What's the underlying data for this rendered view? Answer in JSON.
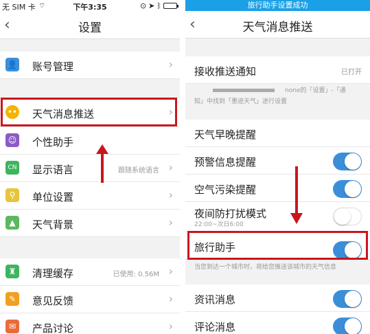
{
  "left": {
    "status": {
      "carrier": "无 SIM 卡 ",
      "time": "下午3:35"
    },
    "nav": {
      "title": "设置"
    },
    "rows": [
      {
        "label": "账号管理",
        "icon": "user-icon",
        "color": "#3e8fd8"
      },
      {
        "label": "天气消息推送",
        "icon": "smile-icon",
        "color": "#f5b400"
      },
      {
        "label": "个性助手",
        "icon": "assistant-icon",
        "color": "#8b5bc5"
      },
      {
        "label": "显示语言",
        "icon": "language-icon",
        "color": "#3db55f",
        "value": "跟随系统语言"
      },
      {
        "label": "单位设置",
        "icon": "unit-icon",
        "color": "#e8c43a"
      },
      {
        "label": "天气背景",
        "icon": "image-icon",
        "color": "#5cb860"
      },
      {
        "label": "清理缓存",
        "icon": "broom-icon",
        "color": "#3db55f",
        "value": "已使用: 0.56M"
      },
      {
        "label": "意见反馈",
        "icon": "pencil-icon",
        "color": "#f0a020"
      },
      {
        "label": "产品讨论",
        "icon": "chat-icon",
        "color": "#ea6b3a"
      }
    ]
  },
  "right": {
    "toast": "旅行助手设置成功",
    "nav": {
      "title": "天气消息推送"
    },
    "receive": {
      "label": "接收推送通知",
      "value": "已打开"
    },
    "note1_line1": "none的「设置」-「通",
    "note1_line2": "知」中找到「墨迹天气」进行设置",
    "rows": [
      {
        "label": "天气早晚提醒"
      },
      {
        "label": "预警信息提醒",
        "on": true
      },
      {
        "label": "空气污染提醒",
        "on": true
      },
      {
        "label": "夜间防打扰模式",
        "sub": "22:00~次日6:00",
        "on": false
      },
      {
        "label": "旅行助手",
        "on": true
      }
    ],
    "note2": "当您到达一个城市时，将给您推送该城市的天气信息",
    "rows2": [
      {
        "label": "资讯消息",
        "on": true
      },
      {
        "label": "评论消息",
        "on": true
      }
    ]
  }
}
